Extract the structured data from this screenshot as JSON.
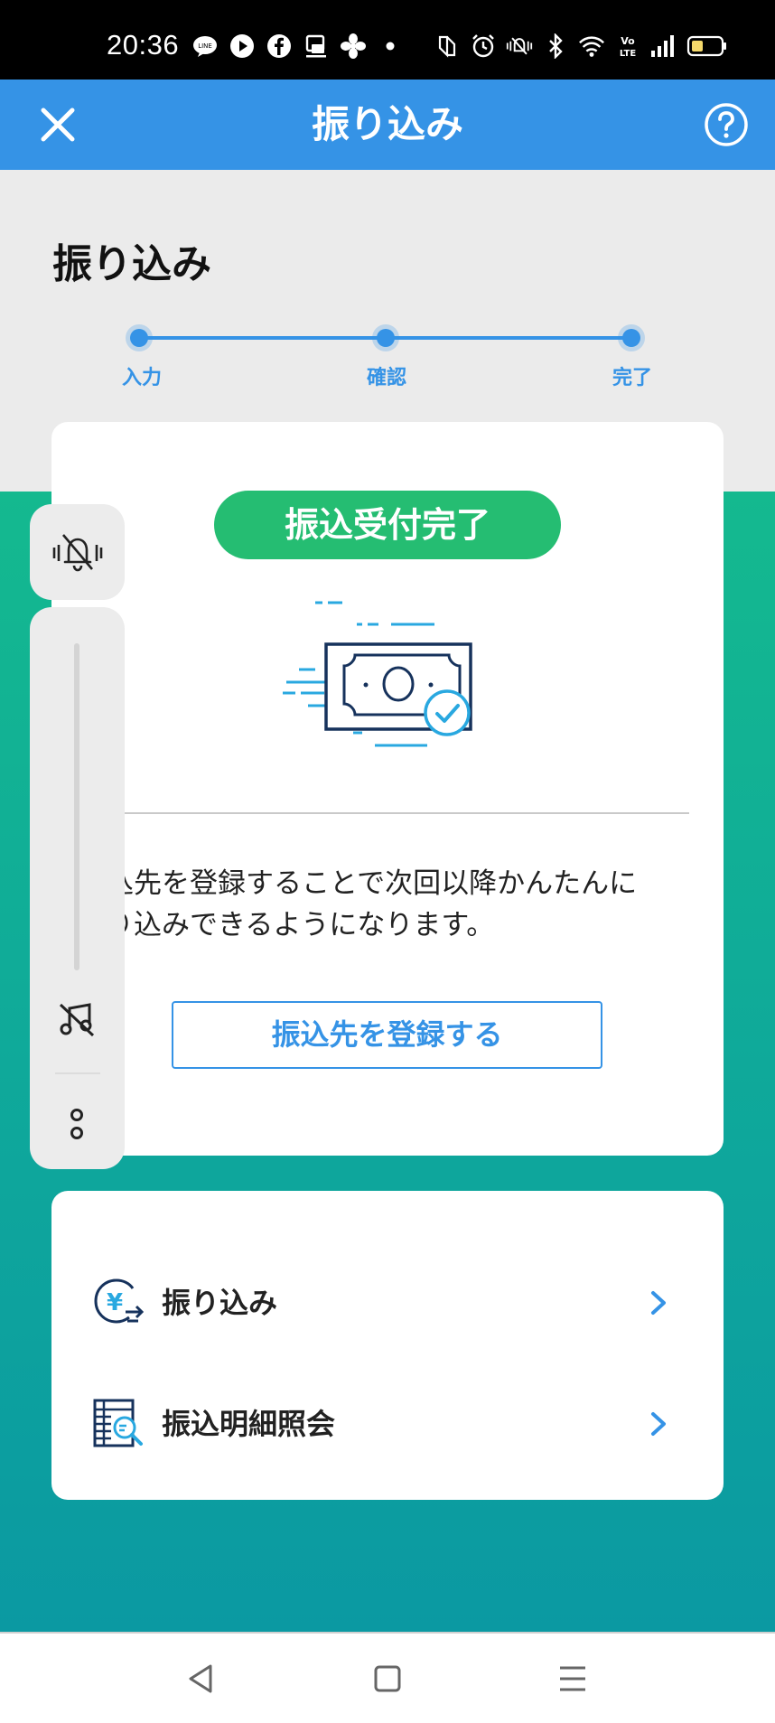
{
  "status_bar": {
    "time": "20:36",
    "left_icons": [
      "line-icon",
      "youtube-icon",
      "facebook-icon",
      "app-notification-icon",
      "fan-icon",
      "dot-icon"
    ],
    "right_icons": [
      "nfc-icon",
      "alarm-icon",
      "vibrate-off-icon",
      "bluetooth-icon",
      "wifi-icon",
      "volte-icon",
      "signal-icon",
      "battery-icon"
    ]
  },
  "header": {
    "title": "振り込み",
    "close_icon": "close-icon",
    "help_icon": "help-icon"
  },
  "page": {
    "title": "振り込み"
  },
  "stepper": {
    "steps": [
      "入力",
      "確認",
      "完了"
    ],
    "current_step": 3
  },
  "result_card": {
    "status_badge": "振込受付完了",
    "illustration": "money-check-icon",
    "message_line1": "込先を登録することで次回以降かんたんに",
    "message_line2": "り込みできるようになります。",
    "register_button": "振込先を登録する"
  },
  "menu": {
    "items": [
      {
        "label": "振り込み",
        "icon": "yen-transfer-icon"
      },
      {
        "label": "振込明細照会",
        "icon": "statement-search-icon"
      }
    ]
  },
  "overlay": {
    "mute_icon": "bell-off-icon",
    "music_icon": "music-off-icon",
    "more_icon": "more-vertical-icon"
  },
  "nav_bar": {
    "back_icon": "back-triangle-icon",
    "home_icon": "home-square-icon",
    "menu_icon": "menu-lines-icon"
  },
  "colors": {
    "primary": "#3593e6",
    "success": "#25bd72",
    "teal": "#12ad97"
  }
}
